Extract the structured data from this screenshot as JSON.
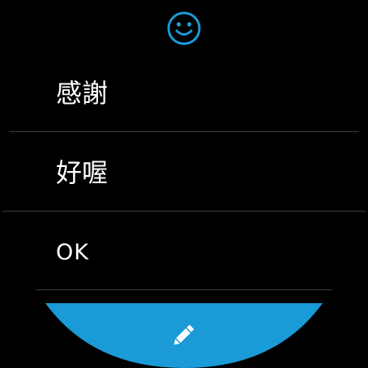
{
  "colors": {
    "background": "#000000",
    "accent": "#1a9ad6",
    "text": "#ffffff",
    "divider": "#3c3c3c"
  },
  "header": {
    "emoji_icon": "smiley-face-icon"
  },
  "replies": [
    {
      "label": "感謝"
    },
    {
      "label": "好喔"
    },
    {
      "label": "OK"
    }
  ],
  "action": {
    "icon": "pencil-icon"
  }
}
